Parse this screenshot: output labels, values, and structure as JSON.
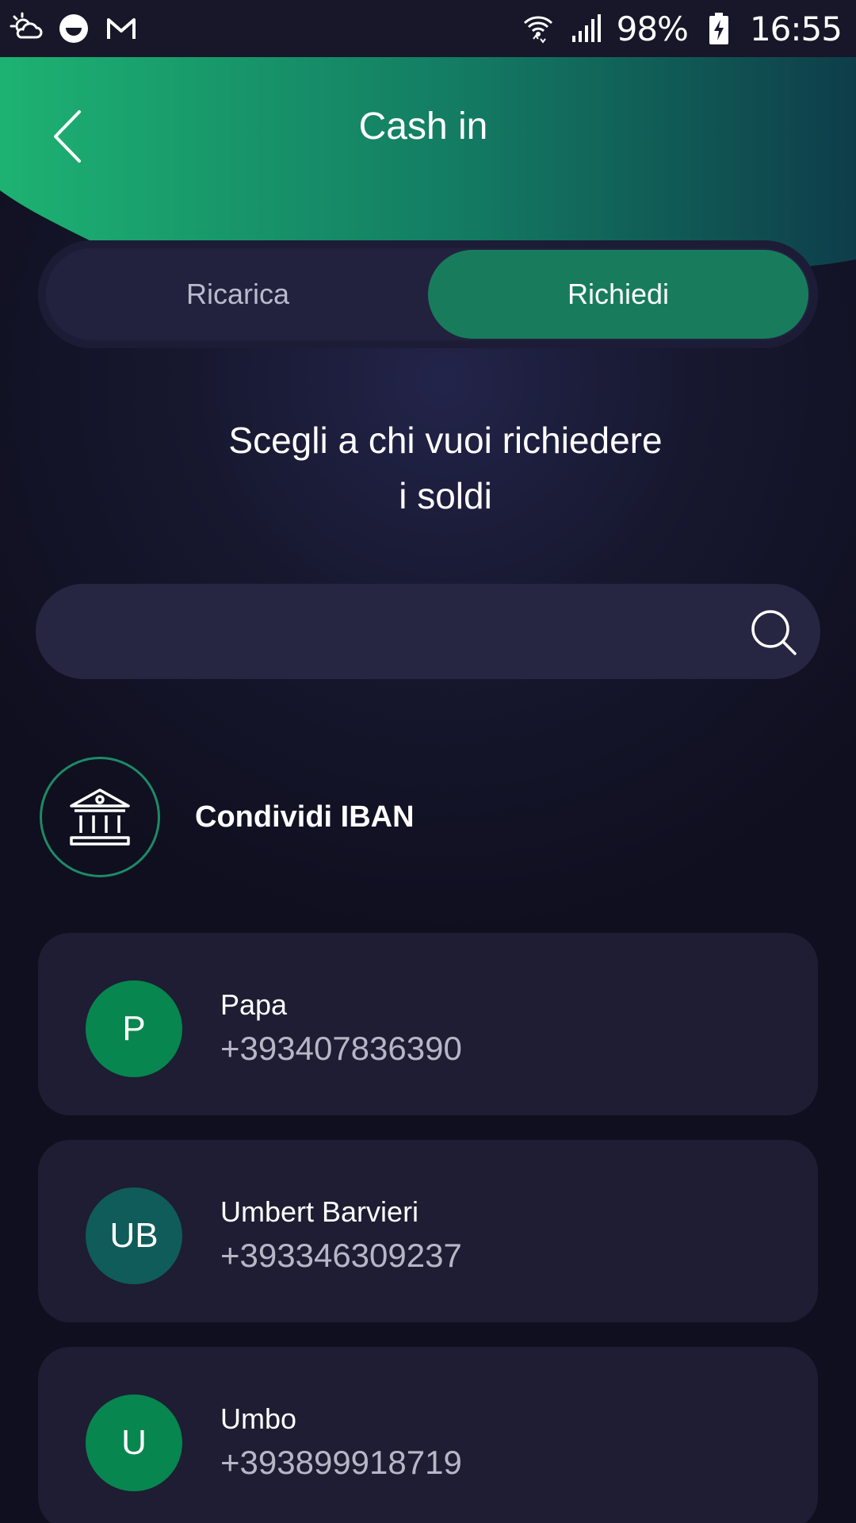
{
  "status_bar": {
    "battery": "98%",
    "time": "16:55",
    "left_icons": [
      "weather-icon",
      "face-icon",
      "mail-icon"
    ],
    "right_icons": [
      "wifi-icon",
      "signal-icon",
      "battery-charging-icon"
    ]
  },
  "header": {
    "title": "Cash in",
    "gradient_start": "#1db272",
    "gradient_end": "#0e3d4a"
  },
  "tabs": [
    {
      "label": "Ricarica",
      "selected": false
    },
    {
      "label": "Richiedi",
      "selected": true
    }
  ],
  "main": {
    "heading_line1": "Scegli a chi vuoi richiedere",
    "heading_line2": "i soldi",
    "search": {
      "placeholder": "",
      "value": ""
    },
    "iban": {
      "label": "Condividi IBAN",
      "icon": "bank-icon"
    }
  },
  "contacts": [
    {
      "initials": "P",
      "name": "Papa",
      "phone": "+393407836390",
      "color": "#07864f"
    },
    {
      "initials": "UB",
      "name": "Umbert Barvieri",
      "phone": "+393346309237",
      "color": "#0f5c5a"
    },
    {
      "initials": "U",
      "name": "Umbo",
      "phone": "+393899918719",
      "color": "#07864f"
    }
  ],
  "colors": {
    "accent": "#187c5c",
    "background": "#13142a",
    "card": "#1e1d33"
  }
}
